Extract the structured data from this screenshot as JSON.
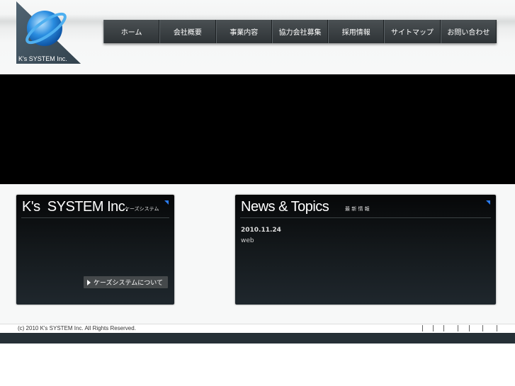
{
  "logo": {
    "text": "K's SYSTEM Inc."
  },
  "nav": {
    "items": [
      "ホーム",
      "会社概要",
      "事業内容",
      "協力会社募集",
      "採用情報",
      "サイトマップ",
      "お問い合わせ"
    ]
  },
  "about_panel": {
    "title": "K's  SYSTEM Inc.",
    "subtitle": "ケーズシステム",
    "button": "ケーズシステムについて"
  },
  "news_panel": {
    "title": "News & Topics",
    "subtitle": "最 新 情 報",
    "items": [
      {
        "date": "2010.11.24",
        "text": "web"
      }
    ]
  },
  "footer": {
    "copyright": "(c) 2010 K's SYSTEM Inc. All Rights Reserved.",
    "separator": "|"
  },
  "colors": {
    "accent": "#2a7cf0",
    "nav_bg": "#3a4043",
    "panel_bg": "#14191c"
  }
}
